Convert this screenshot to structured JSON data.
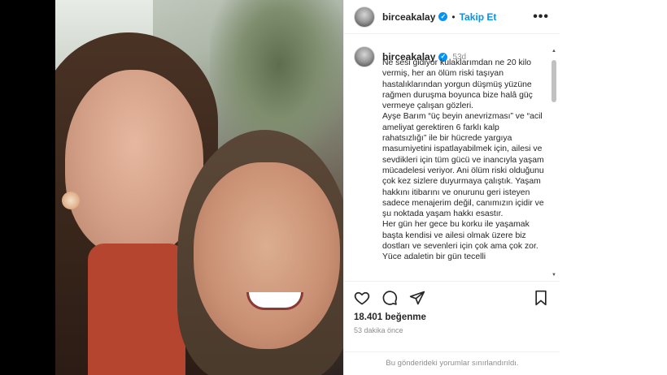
{
  "post": {
    "username": "birceakalay",
    "verified_mark": "✓",
    "separator": "•",
    "follow_label": "Takip Et",
    "more_label": "•••"
  },
  "caption": {
    "username": "birceakalay",
    "time": "53d",
    "paragraphs": [
      "Ne sesi gidiyor kulaklarımdan ne 20 kilo vermiş, her an ölüm riski taşıyan hastalıklarından yorgun düşmüş yüzüne rağmen duruşma boyunca bize halâ güç vermeye çalışan gözleri.",
      "Ayşe Barım “üç beyin anevrizması” ve “acil ameliyat gerektiren 6 farklı kalp rahatsızlığı” ile bir hücrede yargıya masumiyetini ispatlayabilmek için, ailesi ve sevdikleri için tüm gücü ve inancıyla yaşam mücadelesi veriyor. Ani ölüm riski olduğunu çok kez sizlere duyurmaya çalıştık. Yaşam hakkını itibarını ve onurunu geri isteyen sadece menajerim değil, canımızın içidir ve şu noktada yaşam hakkı esastır.",
      "Her gün her gece bu korku ile yaşamak başta kendisi ve ailesi olmak üzere biz dostları ve sevenleri için çok ama çok zor. Yüce adaletin bir gün tecelli"
    ]
  },
  "actions": {
    "likes": "18.401 beğenme",
    "time_ago": "53 dakika önce",
    "comments_off": "Bu gönderideki yorumlar sınırlandırıldı."
  },
  "icons": [
    "heart-icon",
    "comment-icon",
    "share-icon",
    "bookmark-icon",
    "scroll-up-icon",
    "scroll-down-icon"
  ],
  "colors": {
    "accent": "#0095f6",
    "text": "#262626",
    "muted": "#8e8e8e"
  }
}
